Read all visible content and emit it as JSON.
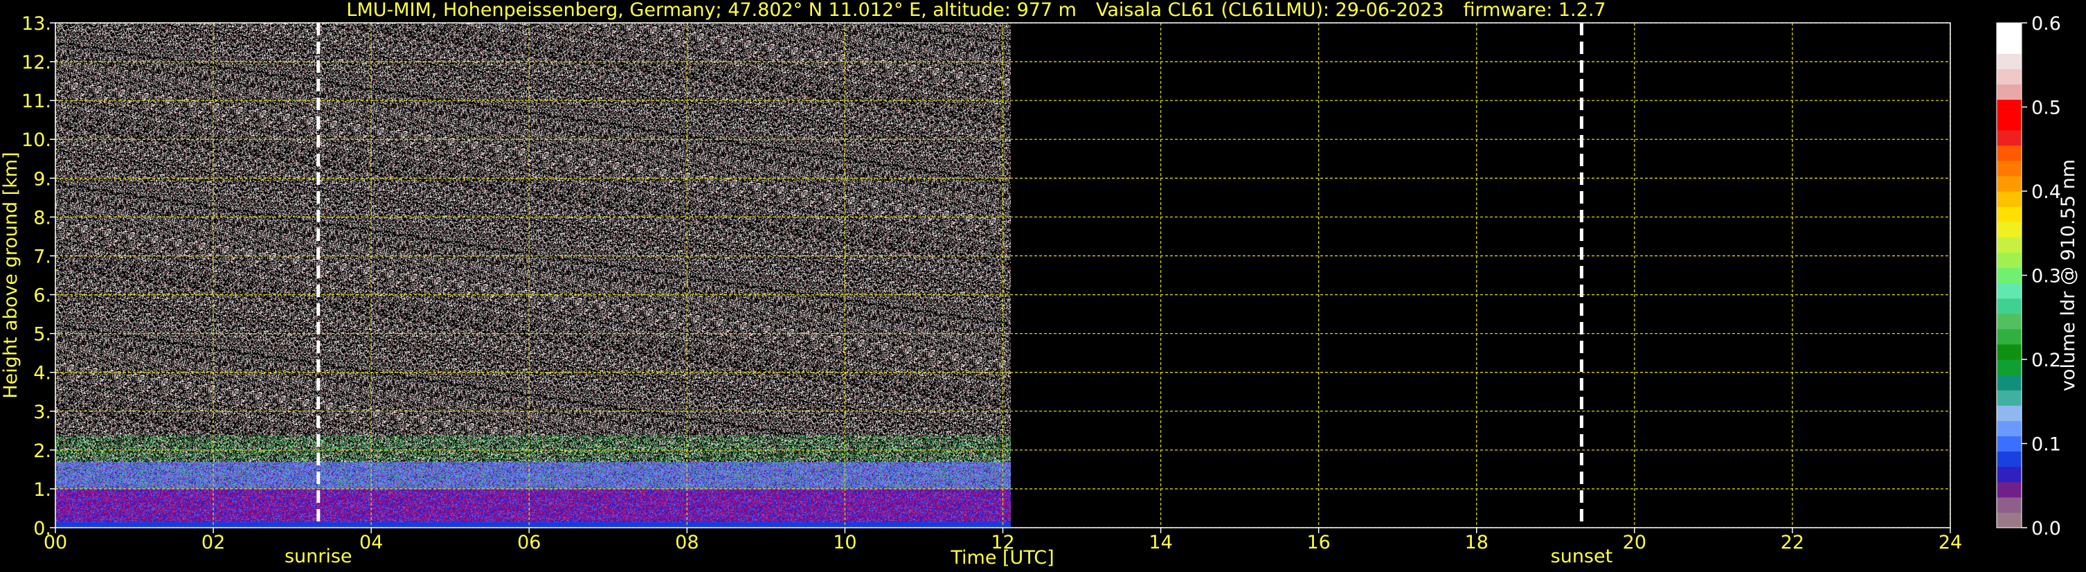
{
  "title": {
    "station": "LMU-MIM, Hohenpeissenberg, Germany; 47.802° N 11.012° E, altitude: 977 m",
    "instrument": "Vaisala CL61 (CL61LMU): 29-06-2023",
    "firmware": "firmware: 1.2.7"
  },
  "chart_data": {
    "type": "heatmap",
    "xlabel": "Time [UTC]",
    "ylabel": "Height above ground [km]",
    "xlim": [
      0,
      24
    ],
    "ylim": [
      0,
      13
    ],
    "x_ticks": [
      "00",
      "02",
      "04",
      "06",
      "08",
      "10",
      "12",
      "14",
      "16",
      "18",
      "20",
      "22",
      "24"
    ],
    "y_ticks": [
      "0.",
      "1.",
      "2.",
      "3.",
      "4.",
      "5.",
      "6.",
      "7.",
      "8.",
      "9.",
      "10.",
      "11.",
      "12.",
      "13."
    ],
    "grid": true,
    "data_extent_hours": [
      0,
      12.1
    ],
    "annotations": [
      {
        "label": "sunrise",
        "time_hours": 3.33
      },
      {
        "label": "sunset",
        "time_hours": 19.33
      }
    ],
    "colorbar": {
      "label": "volume ldr @ 910.55 nm",
      "range": [
        0.0,
        0.6
      ],
      "ticks": [
        "0.0",
        "0.1",
        "0.2",
        "0.3",
        "0.4",
        "0.5",
        "0.6"
      ],
      "colors": [
        "#9a7a88",
        "#8e5f8a",
        "#70208a",
        "#3020c0",
        "#1a40e0",
        "#3a70ff",
        "#6a9aff",
        "#90b8f0",
        "#40b0a0",
        "#10907a",
        "#10a030",
        "#109010",
        "#30b040",
        "#50c060",
        "#40d090",
        "#60e8b0",
        "#70f070",
        "#a0f050",
        "#c8f040",
        "#f0f020",
        "#ffe000",
        "#ffc000",
        "#ff9a00",
        "#ff7a00",
        "#ff5a00",
        "#ee2020",
        "#ff0000",
        "#ff0000",
        "#e8a8a8",
        "#f0c8c8",
        "#f0e0e0",
        "#ffffff",
        "#ffffff"
      ]
    },
    "colors": {
      "axis_text": "#ffff44",
      "grid": "#d8d800",
      "background": "#000000",
      "marker": "#ffffff"
    }
  }
}
